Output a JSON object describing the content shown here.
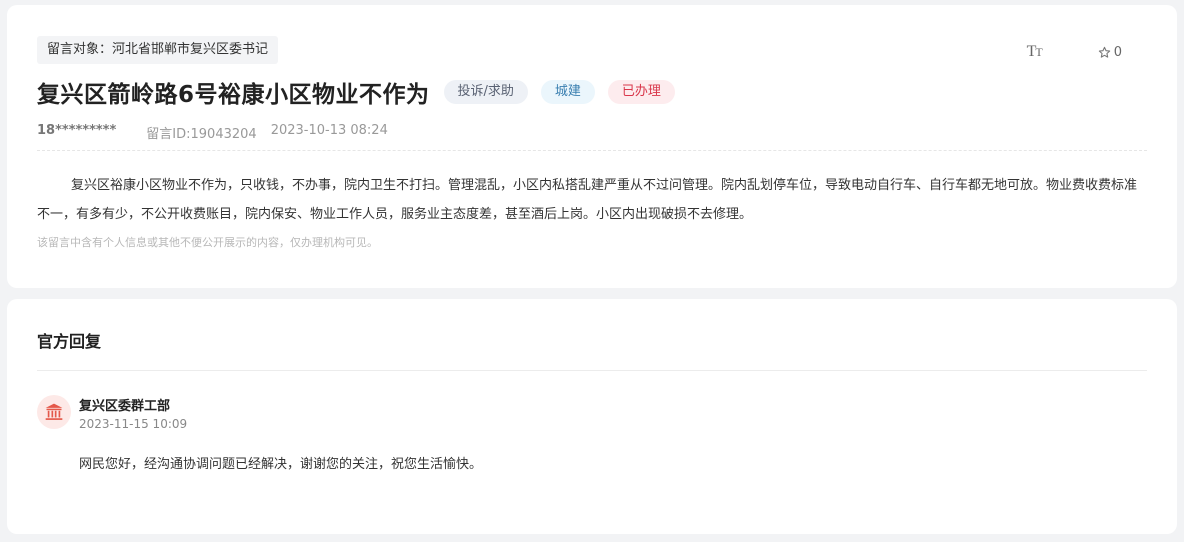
{
  "post": {
    "target_label": "留言对象：河北省邯郸市复兴区委书记",
    "font_size_icon": "font-size-icon",
    "favorite_count": "0",
    "title": "复兴区箭岭路6号裕康小区物业不作为",
    "tags": {
      "type": "投诉/求助",
      "domain": "城建",
      "status": "已办理"
    },
    "user": "18*********",
    "message_id": "留言ID:19043204",
    "date": "2023-10-13 08:24",
    "body": "复兴区裕康小区物业不作为，只收钱，不办事，院内卫生不打扫。管理混乱，小区内私搭乱建严重从不过问管理。院内乱划停车位，导致电动自行车、自行车都无地可放。物业费收费标准不一，有多有少，不公开收费账目，院内保安、物业工作人员，服务业主态度差，甚至酒后上岗。小区内出现破损不去修理。",
    "privacy_note": "该留言中含有个人信息或其他不便公开展示的内容，仅办理机构可见。"
  },
  "reply": {
    "heading": "官方回复",
    "org_name": "复兴区委群工部",
    "time": "2023-11-15 10:09",
    "text": "网民您好，经沟通协调问题已经解决，谢谢您的关注，祝您生活愉快。"
  },
  "colors": {
    "page_bg": "#f2f3f5",
    "status_red": "#d9374b",
    "domain_blue": "#3a7fb0",
    "org_icon_red": "#e4584a"
  }
}
